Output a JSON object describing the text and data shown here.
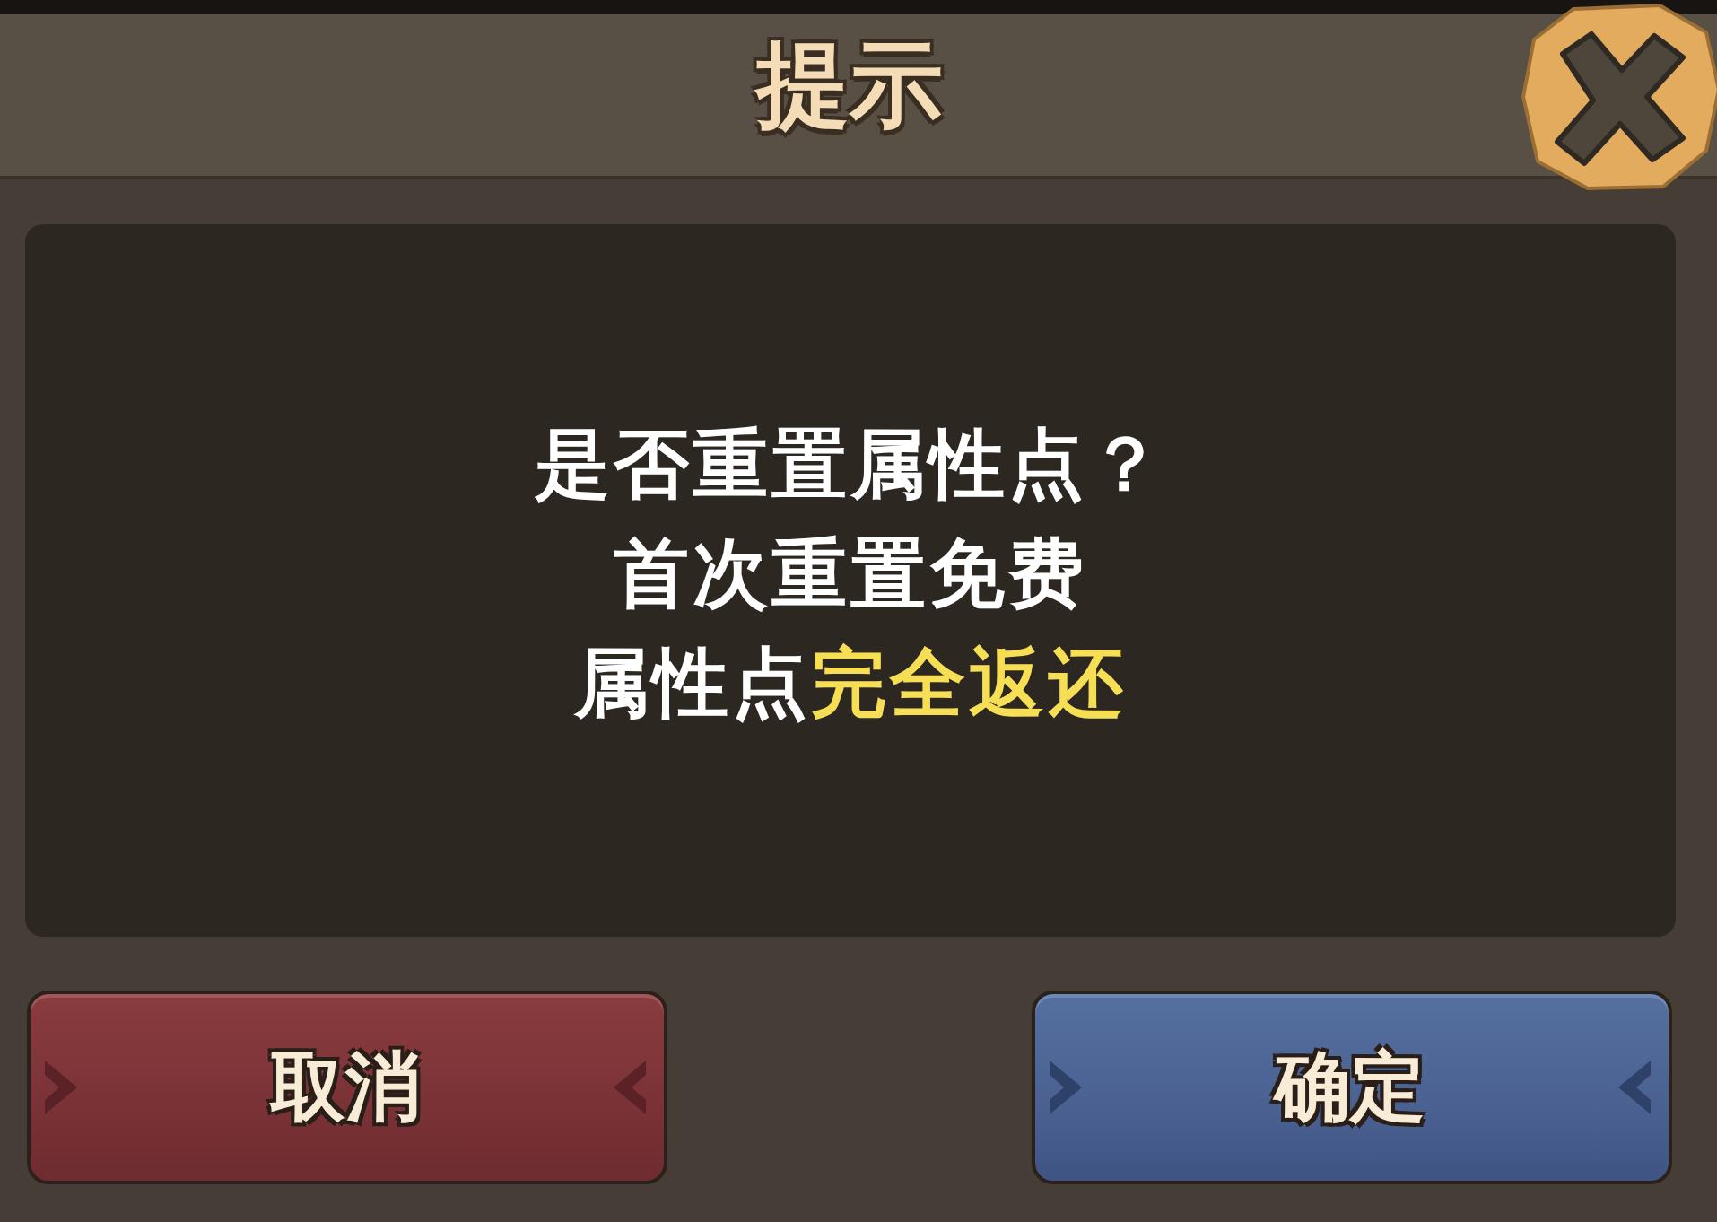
{
  "dialog": {
    "title": "提示",
    "message": [
      "是否重置属性点？",
      "首次重置免费",
      "属性点**完全返还**"
    ],
    "buttons": [
      {
        "label": "取消",
        "kind": "cancel"
      },
      {
        "label": "确定",
        "kind": "confirm"
      }
    ]
  }
}
